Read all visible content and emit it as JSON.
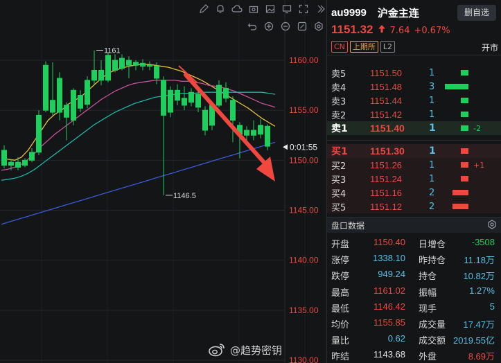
{
  "chart": {
    "y_axis_ticks": [
      "1160.00",
      "1155.00",
      "1150.00",
      "1145.00",
      "1140.00",
      "1135.00",
      "1130.00"
    ],
    "current_price_tag": "0:01:55",
    "high_marker": "1161",
    "low_marker": "1146.5",
    "colors": {
      "up": "#1fce5c",
      "down": "#1fce5c",
      "arrow": "#f0473f",
      "axis_text": "#f0473f"
    }
  },
  "chart_data": {
    "type": "candlestick",
    "y_ticks": [
      1160,
      1155,
      1150,
      1145,
      1140,
      1135,
      1130
    ],
    "ylim": [
      1129.5,
      1163.7
    ],
    "annotations": [
      {
        "label": "1161",
        "value": 1161
      },
      {
        "label": "1146.5",
        "value": 1146.5
      }
    ],
    "current_countdown": "0:01:55",
    "series": [
      {
        "name": "ma_yellow",
        "values": [
          1150.2,
          1150.1,
          1150.0,
          1150.3,
          1151.0,
          1152.0,
          1153.0,
          1154.0,
          1154.6,
          1155.0,
          1155.6,
          1156.0,
          1156.4,
          1157.0,
          1157.6,
          1158.2,
          1158.7,
          1159.0,
          1159.2,
          1159.4,
          1159.5,
          1159.6,
          1159.6,
          1159.5,
          1159.4,
          1159.3,
          1159.1,
          1158.9,
          1158.6,
          1158.3,
          1158.0,
          1157.6,
          1157.2,
          1156.8,
          1156.4,
          1156.0,
          1155.6,
          1155.2,
          1154.7,
          1154.2,
          1153.8,
          1153.4
        ]
      },
      {
        "name": "ma_pink",
        "values": [
          1149.0,
          1149.1,
          1149.3,
          1149.6,
          1150.1,
          1150.7,
          1151.4,
          1152.0,
          1152.6,
          1153.1,
          1153.6,
          1154.1,
          1154.6,
          1155.1,
          1155.6,
          1156.1,
          1156.5,
          1156.9,
          1157.2,
          1157.5,
          1157.7,
          1157.8,
          1157.9,
          1158.0,
          1158.0,
          1158.0,
          1158.0,
          1157.9,
          1157.9,
          1157.8,
          1157.7,
          1157.5,
          1157.4,
          1157.3,
          1157.1,
          1156.9,
          1156.6,
          1156.3,
          1156.0,
          1155.7,
          1155.5,
          1155.3
        ]
      },
      {
        "name": "ma_teal",
        "values": [
          1148.0,
          1148.1,
          1148.2,
          1148.4,
          1148.7,
          1149.1,
          1149.6,
          1150.1,
          1150.6,
          1151.1,
          1151.6,
          1152.1,
          1152.6,
          1153.1,
          1153.6,
          1154.0,
          1154.4,
          1154.8,
          1155.1,
          1155.4,
          1155.7,
          1155.9,
          1156.1,
          1156.3,
          1156.4,
          1156.5,
          1156.6,
          1156.7,
          1156.7,
          1156.7,
          1156.8,
          1156.8,
          1156.8,
          1156.8,
          1156.8,
          1156.8,
          1156.8,
          1156.8,
          1156.8,
          1156.8,
          1156.7,
          1156.6
        ]
      },
      {
        "name": "ma_blue",
        "values": [
          1143.6,
          1143.8,
          1144.0,
          1144.2,
          1144.4,
          1144.6,
          1144.8,
          1145.0,
          1145.2,
          1145.4,
          1145.6,
          1145.8,
          1146.0,
          1146.2,
          1146.4,
          1146.6,
          1146.8,
          1147.0,
          1147.2,
          1147.4,
          1147.6,
          1147.8,
          1148.0,
          1148.2,
          1148.4,
          1148.6,
          1148.8,
          1149.0,
          1149.2,
          1149.4,
          1149.6,
          1149.8,
          1150.0,
          1150.2,
          1150.4,
          1150.6,
          1150.8,
          1151.0,
          1151.2,
          1151.4,
          1151.6,
          1151.8
        ]
      }
    ]
  },
  "toolbar": {
    "row1_icons": [
      "pencil-icon",
      "bell-icon",
      "cloud-icon",
      "camera-icon",
      "image-icon",
      "monitor-icon",
      "fullscreen-icon",
      "collapse-icon"
    ],
    "row2_icons": [
      "undo-icon",
      "zoom-in-icon",
      "zoom-out-icon",
      "fit-icon",
      "settings-icon"
    ]
  },
  "watermark": {
    "text": "@趋势密钥"
  },
  "header": {
    "symbol_code": "au9999",
    "symbol_name": "沪金主连",
    "delete_button": "删自选",
    "last_price": "1151.32",
    "change_abs": "7.64",
    "change_pct": "+0.67%",
    "tag_cn": "CN",
    "tag_exchange": "上期所",
    "tag_level": "L2",
    "market_status": "开市"
  },
  "order_book": {
    "asks": [
      {
        "label": "卖5",
        "price": "1151.50",
        "volume": "1",
        "bar": 0.14,
        "delta": ""
      },
      {
        "label": "卖4",
        "price": "1151.48",
        "volume": "3",
        "bar": 0.43,
        "delta": ""
      },
      {
        "label": "卖3",
        "price": "1151.44",
        "volume": "1",
        "bar": 0.14,
        "delta": ""
      },
      {
        "label": "卖2",
        "price": "1151.42",
        "volume": "1",
        "bar": 0.14,
        "delta": ""
      },
      {
        "label": "卖1",
        "price": "1151.40",
        "volume": "1",
        "bar": 0.14,
        "delta": "-2"
      }
    ],
    "bids": [
      {
        "label": "买1",
        "price": "1151.30",
        "volume": "1",
        "bar": 0.14,
        "delta": ""
      },
      {
        "label": "买2",
        "price": "1151.26",
        "volume": "1",
        "bar": 0.14,
        "delta": "+1"
      },
      {
        "label": "买3",
        "price": "1151.24",
        "volume": "1",
        "bar": 0.14,
        "delta": ""
      },
      {
        "label": "买4",
        "price": "1151.16",
        "volume": "2",
        "bar": 0.29,
        "delta": ""
      },
      {
        "label": "买5",
        "price": "1151.12",
        "volume": "2",
        "bar": 0.29,
        "delta": ""
      }
    ]
  },
  "quote": {
    "title": "盘口数据",
    "rows": [
      {
        "l1": "开盘",
        "v1": "1150.40",
        "c1": "red",
        "l2": "日增仓",
        "v2": "-3508",
        "c2": "green"
      },
      {
        "l1": "涨停",
        "v1": "1338.10",
        "c1": "blue",
        "l2": "昨持仓",
        "v2": "11.18万",
        "c2": "blue"
      },
      {
        "l1": "跌停",
        "v1": "949.24",
        "c1": "blue",
        "l2": "持仓",
        "v2": "10.82万",
        "c2": "blue"
      },
      {
        "l1": "最高",
        "v1": "1161.02",
        "c1": "red",
        "l2": "振幅",
        "v2": "1.27%",
        "c2": "blue"
      },
      {
        "l1": "最低",
        "v1": "1146.42",
        "c1": "red",
        "l2": "现手",
        "v2": "5",
        "c2": "blue"
      },
      {
        "l1": "均价",
        "v1": "1155.85",
        "c1": "red",
        "l2": "成交量",
        "v2": "17.47万",
        "c2": "blue"
      },
      {
        "l1": "量比",
        "v1": "0.62",
        "c1": "blue",
        "l2": "成交额",
        "v2": "2019.55亿",
        "c2": "blue"
      },
      {
        "l1": "昨结",
        "v1": "1143.68",
        "c1": "white",
        "l2": "外盘",
        "v2": "8.69万",
        "c2": "red"
      }
    ]
  }
}
